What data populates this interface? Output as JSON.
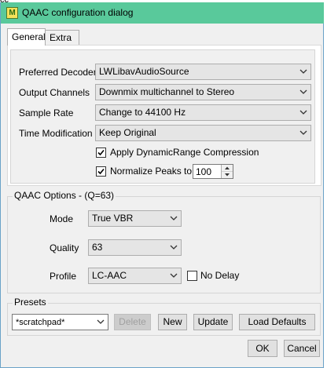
{
  "window": {
    "title": "QAAC configuration dialog",
    "icon": "app-icon"
  },
  "corner_fragment": "cc",
  "tabs": [
    {
      "label": "General",
      "active": true
    },
    {
      "label": "Extra",
      "active": false
    }
  ],
  "general": {
    "preferred_decoder": {
      "label": "Preferred Decoder",
      "value": "LWLibavAudioSource"
    },
    "output_channels": {
      "label": "Output Channels",
      "value": "Downmix multichannel to Stereo"
    },
    "sample_rate": {
      "label": "Sample Rate",
      "value": "Change to 44100 Hz"
    },
    "time_modification": {
      "label": "Time Modification",
      "value": "Keep Original"
    },
    "drc": {
      "label": "Apply DynamicRange Compression",
      "checked": true
    },
    "normalize": {
      "label": "Normalize Peaks to",
      "checked": true,
      "value": "100"
    }
  },
  "qaac_options": {
    "title": "QAAC Options - (Q=63)",
    "mode": {
      "label": "Mode",
      "value": "True VBR"
    },
    "quality": {
      "label": "Quality",
      "value": "63"
    },
    "profile": {
      "label": "Profile",
      "value": "LC-AAC"
    },
    "no_delay": {
      "label": "No Delay",
      "checked": false
    }
  },
  "presets": {
    "title": "Presets",
    "selected": "*scratchpad*",
    "delete_label": "Delete",
    "new_label": "New",
    "update_label": "Update",
    "load_defaults_label": "Load Defaults"
  },
  "buttons": {
    "ok": "OK",
    "cancel": "Cancel"
  }
}
